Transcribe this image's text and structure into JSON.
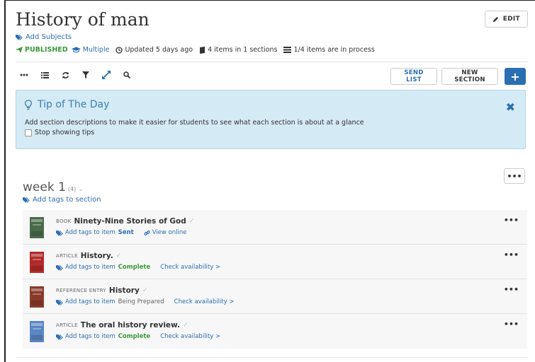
{
  "header": {
    "title": "History of man",
    "edit_label": "EDIT",
    "add_subjects": "Add Subjects"
  },
  "meta": {
    "published": "PUBLISHED",
    "audience": "Multiple",
    "updated": "Updated 5 days ago",
    "items_count": "4 items in 1 sections",
    "in_process": "1/4 items are in process"
  },
  "toolbar": {
    "send_list": "SEND LIST",
    "new_section": "NEW SECTION",
    "add": "+"
  },
  "tip": {
    "title": "Tip of The Day",
    "description": "Add section descriptions to make it easier for students to see what each section is about at a glance",
    "stop": "Stop showing tips"
  },
  "section": {
    "title": "week 1",
    "count": "(4)",
    "add_tags": "Add tags to section",
    "more": "•••"
  },
  "items": [
    {
      "type": "BOOK",
      "title": "Ninety-Nine Stories of God",
      "tags": "Add tags to item",
      "status": "Sent",
      "status_kind": "sent",
      "link": "View online",
      "thumb_color": "#4a6b4a"
    },
    {
      "type": "ARTICLE",
      "title": "History.",
      "tags": "Add tags to item",
      "status": "Complete",
      "status_kind": "complete",
      "link": "Check availability >",
      "thumb_color": "#b22a2a"
    },
    {
      "type": "REFERENCE ENTRY",
      "title": "History",
      "tags": "Add tags to item",
      "status": "Being Prepared",
      "status_kind": "prep",
      "link": "Check availability >",
      "thumb_color": "#8a3a2a"
    },
    {
      "type": "ARTICLE",
      "title": "The oral history review.",
      "tags": "Add tags to item",
      "status": "Complete",
      "status_kind": "complete",
      "link": "Check availability >",
      "thumb_color": "#5a86c4"
    }
  ],
  "colors": {
    "accent": "#2a6fb0",
    "success": "#3a9a3a",
    "tip_bg": "#d4eaf5"
  }
}
